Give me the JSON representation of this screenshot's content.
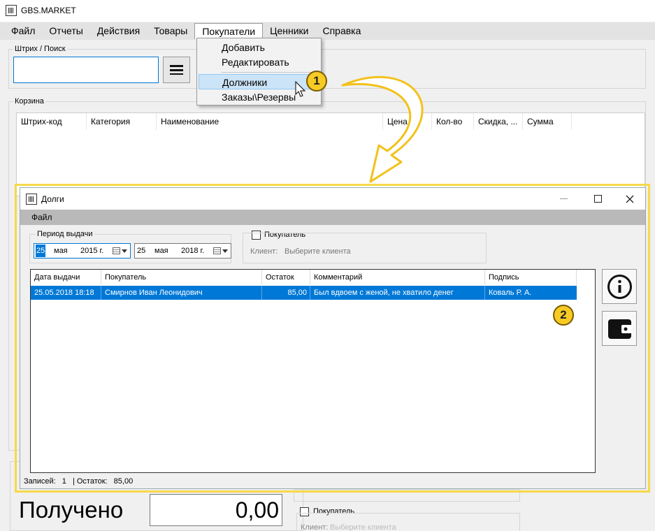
{
  "app": {
    "title": "GBS.MARKET"
  },
  "menu": [
    "Файл",
    "Отчеты",
    "Действия",
    "Товары",
    "Покупатели",
    "Ценники",
    "Справка"
  ],
  "dropdown": [
    "Добавить",
    "Редактировать",
    "Должники",
    "Заказы\\Резервы"
  ],
  "search": {
    "legend": "Штрих / Поиск",
    "value": ""
  },
  "cart": {
    "legend": "Корзина",
    "columns": [
      "Штрих-код",
      "Категория",
      "Наименование",
      "Цена",
      "Кол-во",
      "Скидка, ...",
      "Сумма"
    ]
  },
  "received": {
    "label": "Получено",
    "value": "0,00"
  },
  "bottom_customer": {
    "label": "Покупатель",
    "client_label": "Клиент:",
    "client_placeholder": "Выберите клиента"
  },
  "badges": [
    "1",
    "2"
  ],
  "debts_dialog": {
    "title": "Долги",
    "menu_file": "Файл",
    "period": {
      "legend": "Период выдачи",
      "from": {
        "day": "25",
        "month": "мая",
        "year": "2015 г."
      },
      "to": {
        "day": "25",
        "month": "мая",
        "year": "2018 г."
      }
    },
    "customer_filter": {
      "label": "Покупатель",
      "client_label": "Клиент:",
      "client_placeholder": "Выберите клиента"
    },
    "columns": [
      "Дата выдачи",
      "Покупатель",
      "Остаток",
      "Комментарий",
      "Подпись"
    ],
    "rows": [
      {
        "date": "25.05.2018 18:18",
        "customer": "Смирнов Иван Леонидович",
        "balance": "85,00",
        "comment": "Был вдвоем с женой, не хватило денег",
        "signature": "Коваль Р. А."
      }
    ],
    "status": {
      "records_label": "Записей:",
      "records": "1",
      "balance_label": "| Остаток:",
      "balance": "85,00"
    }
  },
  "colors": {
    "accent": "#0078d7",
    "highlight": "#f7d84a",
    "badge": "#f7cb24",
    "menubar": "#e3e3e3"
  }
}
